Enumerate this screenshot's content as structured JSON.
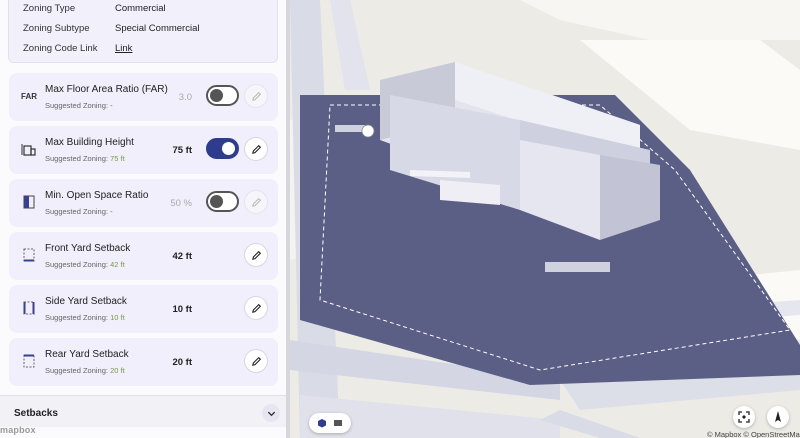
{
  "colors": {
    "lot": "#5b5f86",
    "toggle_on": "#2e3c8e",
    "suggested_green": "#7a9a4a"
  },
  "info": {
    "rows": [
      {
        "label": "Zoning Type",
        "value": "Commercial"
      },
      {
        "label": "Zoning Subtype",
        "value": "Special Commercial"
      },
      {
        "label": "Zoning Code Link",
        "value": "Link"
      }
    ]
  },
  "cards": [
    {
      "icon": "far-icon",
      "icon_text": "FAR",
      "title": "Max Floor Area Ratio (FAR)",
      "suggested_label": "Suggested Zoning:",
      "suggested_value": "-",
      "value": "3.0",
      "toggle": "off"
    },
    {
      "icon": "building-height-icon",
      "title": "Max Building Height",
      "suggested_label": "Suggested Zoning:",
      "suggested_value": "75 ft",
      "value": "75 ft",
      "toggle": "on"
    },
    {
      "icon": "open-space-icon",
      "title": "Min. Open Space Ratio",
      "suggested_label": "Suggested Zoning:",
      "suggested_value": "-",
      "value": "50 %",
      "toggle": "off"
    },
    {
      "icon": "front-setback-icon",
      "title": "Front Yard Setback",
      "suggested_label": "Suggested Zoning:",
      "suggested_value": "42 ft",
      "value": "42 ft"
    },
    {
      "icon": "side-setback-icon",
      "title": "Side Yard Setback",
      "suggested_label": "Suggested Zoning:",
      "suggested_value": "10 ft",
      "value": "10 ft"
    },
    {
      "icon": "rear-setback-icon",
      "title": "Rear Yard Setback",
      "suggested_label": "Suggested Zoning:",
      "suggested_value": "20 ft",
      "value": "20 ft"
    }
  ],
  "footer": {
    "label": "Setbacks"
  },
  "attribution": {
    "logo": "mapbox",
    "text": "© Mapbox © OpenStreetMa"
  }
}
